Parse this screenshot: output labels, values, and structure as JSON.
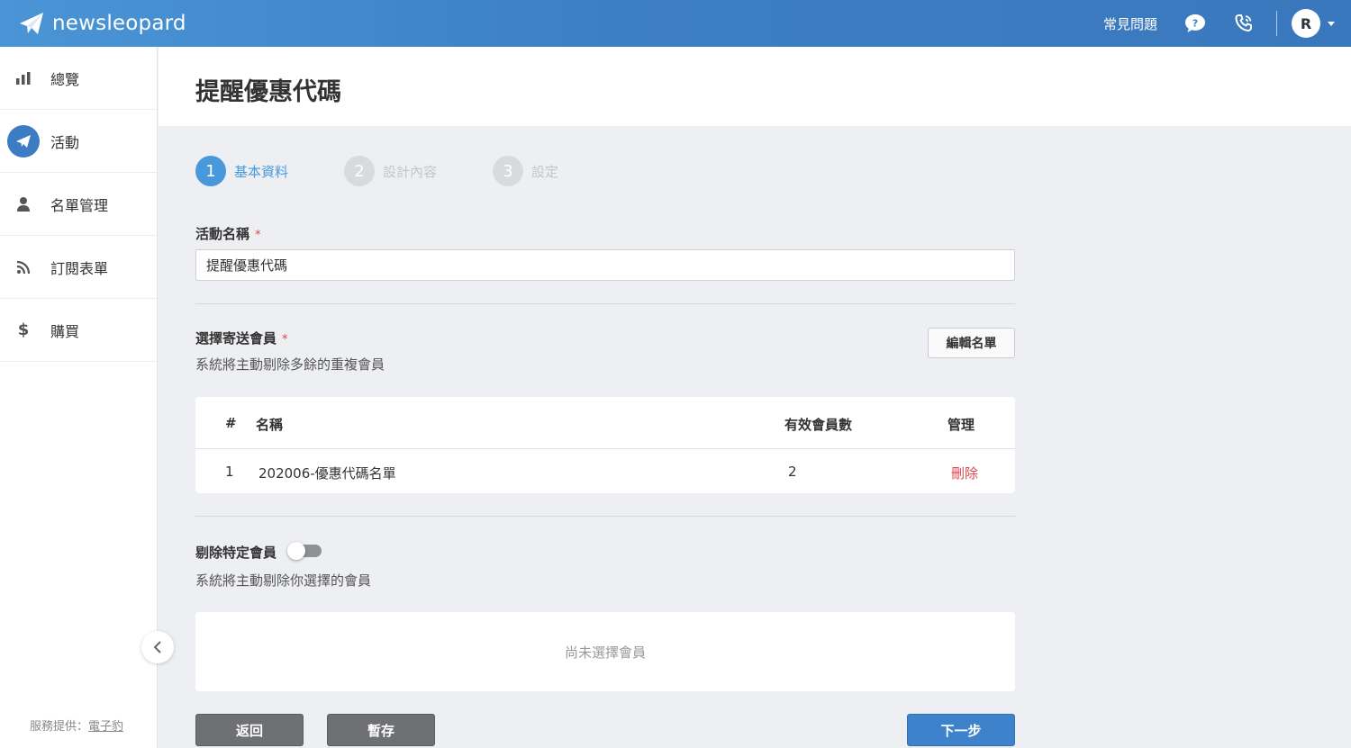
{
  "app": {
    "brand": "newsleopard",
    "brand_color": "#4a95d6"
  },
  "topbar": {
    "faq_label": "常見問題",
    "avatar_letter": "R"
  },
  "sidebar": {
    "items": [
      {
        "label": "總覽",
        "icon": "bar-chart-icon"
      },
      {
        "label": "活動",
        "icon": "paper-plane-icon",
        "active": true
      },
      {
        "label": "名單管理",
        "icon": "user-icon"
      },
      {
        "label": "訂閱表單",
        "icon": "rss-icon"
      },
      {
        "label": "購買",
        "icon": "dollar-icon"
      }
    ],
    "powered_by": "服務提供：",
    "powered_link": "電子豹"
  },
  "page": {
    "title": "提醒優惠代碼"
  },
  "steps": [
    {
      "number": "1",
      "label": "基本資料",
      "active": true
    },
    {
      "number": "2",
      "label": "設計內容",
      "active": false
    },
    {
      "number": "3",
      "label": "設定",
      "active": false
    }
  ],
  "form": {
    "campaign_name_label": "活動名稱",
    "required_mark": "*",
    "campaign_name_value": "提醒優惠代碼",
    "recipients_label": "選擇寄送會員",
    "recipients_hint": "系統將主動剔除多餘的重複會員",
    "edit_list_button": "編輯名單",
    "table": {
      "headers": [
        "#",
        "名稱",
        "有效會員數",
        "管理"
      ],
      "rows": [
        {
          "index": "1",
          "name": "202006-優惠代碼名單",
          "count": "2",
          "action": "刪除"
        }
      ]
    },
    "exclude_label": "剔除特定會員",
    "exclude_toggle_on": false,
    "exclude_hint": "系統將主動剔除你選擇的會員",
    "exclude_empty": "尚未選擇會員"
  },
  "buttons": {
    "back": "返回",
    "save_draft": "暫存",
    "next": "下一步"
  }
}
